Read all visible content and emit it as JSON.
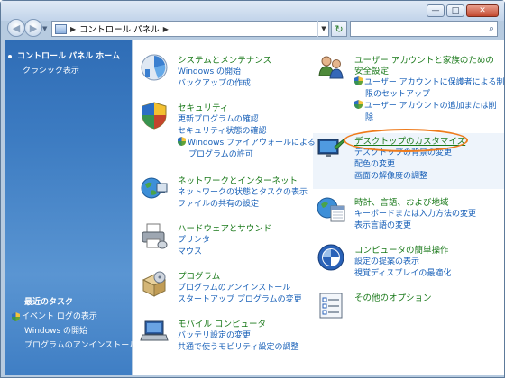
{
  "window": {
    "minimize_glyph": "—",
    "maximize_glyph": "□",
    "close_glyph": "✕"
  },
  "navigation": {
    "back_glyph": "◀",
    "forward_glyph": "▶",
    "dropdown_glyph": "▼",
    "address_separator": "▶",
    "address_crumb": "コントロール パネル",
    "address_crumb_sep": "▶",
    "address_dropdown_glyph": "▼",
    "refresh_glyph": "↻",
    "search_glyph": "⌕"
  },
  "sidebar": {
    "items": [
      {
        "label": "コントロール パネル ホーム"
      },
      {
        "label": "クラシック表示"
      }
    ],
    "recent_tasks_heading": "最近のタスク",
    "recent_tasks": [
      {
        "label": "イベント ログの表示"
      },
      {
        "label": "Windows の開始"
      },
      {
        "label": "プログラムのアンインストール"
      }
    ]
  },
  "categories_left": [
    {
      "icon": "system-maintenance-icon",
      "title": "システムとメンテナンス",
      "links": [
        "Windows の開始",
        "バックアップの作成"
      ]
    },
    {
      "icon": "security-shield-icon",
      "title": "セキュリティ",
      "links": [
        "更新プログラムの確認",
        "セキュリティ状態の確認",
        "Windows ファイアウォールによる",
        "プログラムの許可"
      ]
    },
    {
      "icon": "network-globe-icon",
      "title": "ネットワークとインターネット",
      "links": [
        "ネットワークの状態とタスクの表示",
        "ファイルの共有の設定"
      ]
    },
    {
      "icon": "hardware-printer-icon",
      "title": "ハードウェアとサウンド",
      "links": [
        "プリンタ",
        "マウス"
      ]
    },
    {
      "icon": "programs-box-icon",
      "title": "プログラム",
      "links": [
        "プログラムのアンインストール",
        "スタートアップ プログラムの変更"
      ]
    },
    {
      "icon": "mobile-pc-icon",
      "title": "モバイル コンピュータ",
      "links": [
        "バッテリ設定の変更",
        "共通で使うモビリティ設定の調整"
      ]
    }
  ],
  "categories_right": [
    {
      "icon": "user-accounts-icon",
      "title_line1": "ユーザー アカウントと家族のための",
      "title_line2": "安全設定",
      "links": [
        "ユーザー アカウントに保護者による制",
        "限のセットアップ",
        "ユーザー アカウントの追加または削",
        "除"
      ]
    },
    {
      "icon": "appearance-desktop-icon",
      "title": "デスクトップのカスタマイズ",
      "links": [
        "デスクトップの背景の変更",
        "配色の変更",
        "画面の解像度の調整"
      ]
    },
    {
      "icon": "clock-language-icon",
      "title": "時計、言語、および地域",
      "links": [
        "キーボードまたは入力方法の変更",
        "表示言語の変更"
      ]
    },
    {
      "icon": "ease-of-access-icon",
      "title": "コンピュータの簡単操作",
      "links": [
        "設定の提案の表示",
        "視覚ディスプレイの最適化"
      ]
    },
    {
      "icon": "additional-options-icon",
      "title": "その他のオプション",
      "links": []
    }
  ],
  "colors": {
    "sidebar": "#3d7cc2",
    "category_title": "#1b7a1b",
    "link": "#1860b8",
    "highlight_oval": "#ee7b1c"
  }
}
